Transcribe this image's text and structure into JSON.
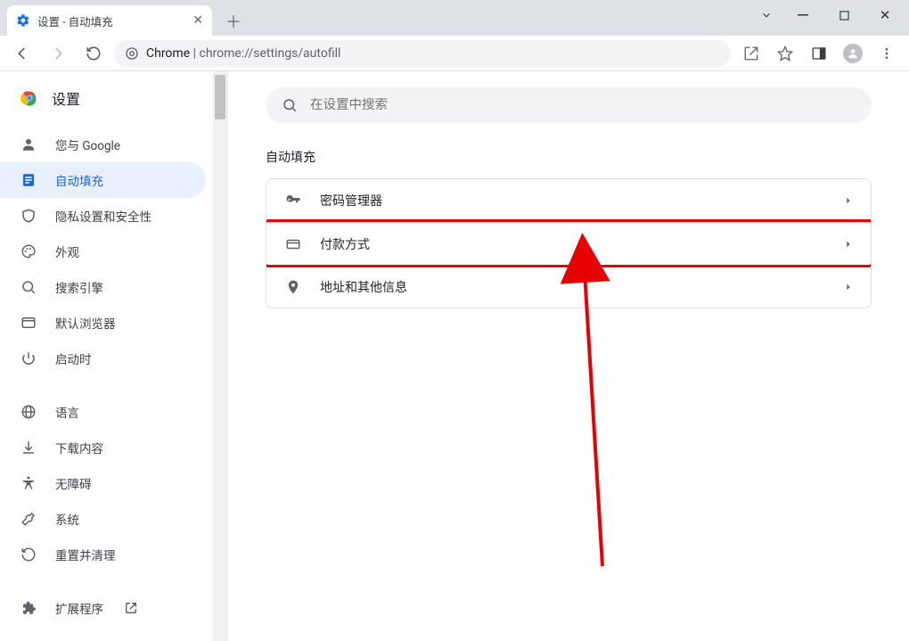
{
  "window": {
    "tab_title": "设置 - 自动填充"
  },
  "omnibox": {
    "scheme_host": "Chrome",
    "url": "chrome://settings/autofill"
  },
  "app_title": "设置",
  "search": {
    "placeholder": "在设置中搜索"
  },
  "sidebar": {
    "items": [
      {
        "icon": "person",
        "label": "您与 Google"
      },
      {
        "icon": "autofill",
        "label": "自动填充",
        "selected": true
      },
      {
        "icon": "shield",
        "label": "隐私设置和安全性"
      },
      {
        "icon": "palette",
        "label": "外观"
      },
      {
        "icon": "search",
        "label": "搜索引擎"
      },
      {
        "icon": "browser",
        "label": "默认浏览器"
      },
      {
        "icon": "power",
        "label": "启动时"
      }
    ],
    "items2": [
      {
        "icon": "globe",
        "label": "语言"
      },
      {
        "icon": "download",
        "label": "下载内容"
      },
      {
        "icon": "accessibility",
        "label": "无障碍"
      },
      {
        "icon": "wrench",
        "label": "系统"
      },
      {
        "icon": "refresh",
        "label": "重置并清理"
      }
    ],
    "items3": [
      {
        "icon": "puzzle",
        "label": "扩展程序",
        "external": true
      }
    ]
  },
  "section": {
    "title": "自动填充",
    "rows": [
      {
        "icon": "key",
        "label": "密码管理器"
      },
      {
        "icon": "card",
        "label": "付款方式",
        "highlight": true
      },
      {
        "icon": "pin",
        "label": "地址和其他信息"
      }
    ]
  }
}
